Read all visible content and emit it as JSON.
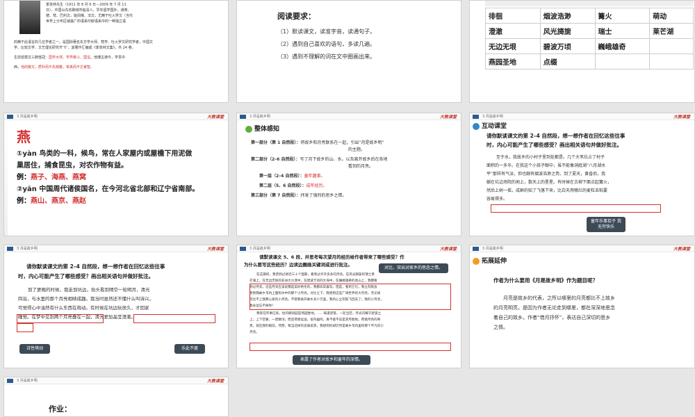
{
  "common": {
    "header_tag": "3 月是故乡明",
    "logo": "大教课堂"
  },
  "s1": {
    "lines": [
      "季羡林先生（1911 年 8 月 6 日－2009 年 7 月 11",
      "日），中国山东省聊城市临清人。早年留学国外，通英、",
      "德、梵、巴利文，能阅俄、法文，尤精于吐火罗文（当代",
      "世界上分布区域最广的语系印欧语系中的一种独立语",
      "的精于此语言的几位学者之一。是国际著名东方学大师、梵学、吐火罗文研究学者，中国文",
      "学、比较文学、文艺理论研究齐飞”，其著作汇编成《季羡林文集》，共 24 卷。"
    ],
    "honor_prefix": "生前曾撰文三辞桂冠：",
    "honors": "国学大师、学界泰斗、国宝",
    "honor_mid": "。他博古通今，学贯中",
    "style_prefix": "西，",
    "style": "他的散文，质朴而不失典雅，率真而不乏睿智。"
  },
  "s2": {
    "title": "阅读要求：",
    "items": [
      "（1）默读课文，读准字音，读通句子。",
      "（2）遇到自己喜欢的语句，多读几遍。",
      "（3）遇到不理解的词在文中圈画出来。"
    ]
  },
  "s3": {
    "rows": [
      [
        "徘徊",
        "烟波浩渺",
        "篝火",
        "萌动"
      ],
      [
        "澄澈",
        "风光旖旎",
        "瑞士",
        "莱芒湖"
      ],
      [
        "无边无垠",
        "碧波万顷",
        "巍峨雄奇",
        ""
      ],
      [
        "燕园圣地",
        "点缀",
        "",
        ""
      ]
    ]
  },
  "s4": {
    "char": "燕",
    "p1_label": "①yàn 鸟类的一科，候鸟，常在人家屋内或屋檐下用泥做",
    "p1_cont": "巢居住，捕食昆虫，对农作物有益。",
    "e1_prefix": "例：",
    "e1": "燕子、海燕、燕窝",
    "p2": "②yān 中国周代诸侯国名，在今河北省北部和辽宁省南部。",
    "e2_prefix": "例：",
    "e2": "燕山、燕京、燕赵"
  },
  "s5": {
    "title": "整体感知",
    "parts": [
      {
        "label": "第一部分（第 1 自然段）：",
        "text": "将故乡和月亮联系在一起，引出“月是故乡明”",
        "cont": "的主题。"
      },
      {
        "label": "第二部分（2–6 自然段）：",
        "text": "写了月下故乡的山、水，以及离开故乡后在各地",
        "cont": "看到的月亮。"
      }
    ],
    "layers": [
      {
        "label": "第一层（2–4 自然段）：",
        "text": "童年趣事。"
      },
      {
        "label": "第二层（5、6 自然段）：",
        "text": "成年经历。"
      }
    ],
    "part3_label": "第三部分（第 7 自然段）：",
    "part3_text": "抒发了强烈的思乡之情。"
  },
  "s6": {
    "title": "互动课堂",
    "q1": "请你默读课文的第 2–4 自然段，想一想作者在回忆这些往事",
    "q2": "时，内心可能产生了哪些感受？画出相关语句并做好批注。",
    "lines": [
      "至于水，我故乡的小村子里到处都是。几个大苇坑占了村子",
      "面积的一多半。在我这个小孩子眼中，虽不能像洞庭湖“八月湖水",
      "平”那样有气派，但也颇有烟波浩渺之势。到了夏天，黄昏后，我",
      "躺在坑边场院的地上，数天上的星星。有时候在古柳下面点起篝火，",
      "然后上树一摇，成群的知了飞落下来，比白天用嚼烂的麦粒去粘要",
      "容易得多。"
    ],
    "note": "童年乐事拾子 我无穷快乐"
  },
  "s7": {
    "q1": "请你默读课文的第 2–4 自然段，想一想作者在回忆这些往事",
    "q2": "时，内心可能产生了哪些感受？画出相关语句并做好批注。",
    "lines": [
      "到了更晚的时候，我走到坑边，抬头看到晴空一轮明月，清光",
      "四溢，与水里的那个月亮相映成趣。我当时虽然还不懂什么叫诗兴，",
      "可觉得心中油然有什么东西在萌动。有时候在坑边玩很久，才回家",
      "睡觉。在梦中见到两个月亮叠在一起，清光更加晶莹澄澈。"
    ],
    "note_left": "诗性萌动",
    "note_right": "乐此不疲"
  },
  "s8": {
    "q1": "请默读课文 5、6 段，并思考每次望月的经历给作者带来了哪些感受？作",
    "q2": "为什么要写这些经历？边读边圈画关键词或进行批注。",
    "lines": [
      "在这期间，我曾到过将近三十个国家，看到过许许多多的月亮。在风光旖旎的瑞士莱",
      "芒湖上，在无边无垠的非洲大沙漠中，在碧波万顷的大海中，在巍峨雄奇的高山上，我都看",
      "到过月亮。这些月亮应该说都是美妙绝伦的，我都非常喜欢。但是，看到它们，我立刻就会",
      "想到我故乡苇坑上面和水中的那个小月亮。对比之下，我感到这些广阔世界的大月亮，无论如",
      "何比不上我那心爱的小月亮。不管我离开故乡多少万里，我的心立刻就飞回去了。我的小月亮，",
      "我永远忘不掉你！",
      "我现在年事已高，住的朗润园是燕园胜地。……每逢望夜，一轮当空，月光闪耀于碧波之",
      "上，上下空蒙，一碧数顷，而且荷香远溢，宿鸟幽鸣，真不能不说是赏月胜地。荷塘月色的奇",
      "景，就在我的眼前。然而，每当这样的良辰美景，我想到的却仍然是故乡苇坑里的那个平凡的小",
      "月亮。"
    ],
    "note_top": "对比，突出对家乡的思念之情。",
    "note_bottom": "表露了作者对故乡和童年的深情。"
  },
  "s9": {
    "title": "拓展延伸",
    "q": "作者为什么要用《月是故乡明》作为题目呢？",
    "lines": [
      "月亮是故乡的代表，之所以哪里的月亮都比不上故乡",
      "的月亮明亮，是因为作者无论走到哪里，都在深深地思念",
      "着自己的故乡。作者“借月抒怀”，表达自己深切的思乡",
      "之情。"
    ]
  },
  "s10": {
    "title": "作业："
  }
}
